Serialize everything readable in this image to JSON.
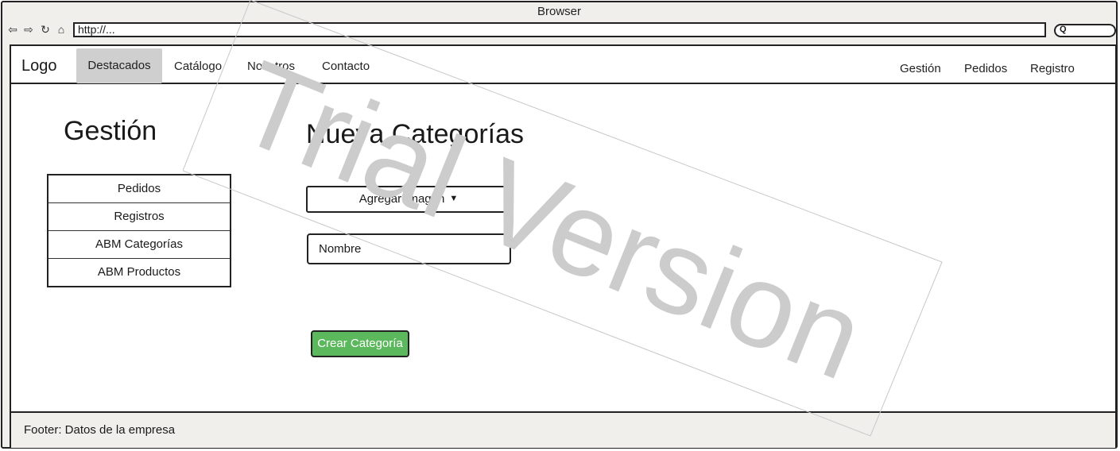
{
  "browser": {
    "title": "Browser",
    "url": "http://...",
    "icons": [
      "back-icon",
      "forward-icon",
      "reload-icon",
      "home-icon",
      "search-icon"
    ]
  },
  "topnav": {
    "logo": "Logo",
    "items": [
      "Destacados",
      "Catálogo",
      "Nosotros",
      "Contacto"
    ],
    "right_items": [
      "Gestión",
      "Pedidos",
      "Registro"
    ]
  },
  "sidebar": {
    "title": "Gestión",
    "items": [
      "Pedidos",
      "Registros",
      "ABM Categorías",
      "ABM Productos"
    ]
  },
  "form": {
    "title": "Nueva Categorías",
    "image_button": "Agregar Imagen",
    "name_placeholder": "Nombre",
    "submit_label": "Crear Categoría",
    "submit_color": "#5cb85c"
  },
  "footer": {
    "text": "Footer: Datos de la empresa"
  },
  "watermark": {
    "text": "Trial Version",
    "color": "#cccccc"
  }
}
